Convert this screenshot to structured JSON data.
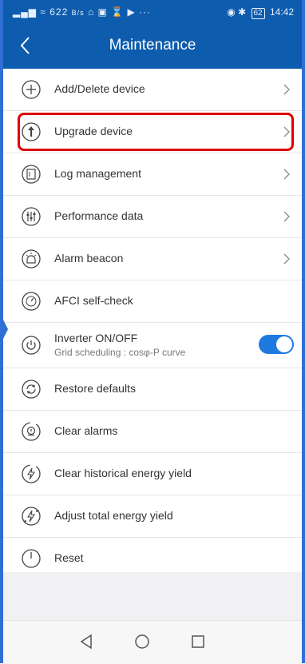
{
  "status_bar": {
    "left": "\"∙ıı ≈ 622 B/s …",
    "net_speed": "622",
    "net_unit": "B/s",
    "battery": "62",
    "time": "14:42"
  },
  "header": {
    "title": "Maintenance"
  },
  "menu": [
    {
      "label": "Add/Delete device",
      "icon": "plus-circle-icon"
    },
    {
      "label": "Upgrade device",
      "icon": "upload-arrow-icon"
    },
    {
      "label": "Log management",
      "icon": "document-icon"
    },
    {
      "label": "Performance data",
      "icon": "sliders-icon"
    },
    {
      "label": "Alarm beacon",
      "icon": "alarm-light-icon"
    },
    {
      "label": "AFCI self-check",
      "icon": "gauge-icon"
    },
    {
      "label": "Inverter ON/OFF",
      "sublabel": "Grid scheduling : cosφ-P curve",
      "icon": "power-icon",
      "toggle_on": true
    },
    {
      "label": "Restore defaults",
      "icon": "restore-icon"
    },
    {
      "label": "Clear alarms",
      "icon": "clear-alarm-icon"
    },
    {
      "label": "Clear historical energy yield",
      "icon": "lightning-icon"
    },
    {
      "label": "Adjust total energy yield",
      "icon": "lightning-adjust-icon"
    },
    {
      "label": "Reset",
      "icon": "reset-icon"
    }
  ],
  "colors": {
    "header": "#0d5cad",
    "accent": "#1f7ae0",
    "highlight": "#e00000"
  }
}
